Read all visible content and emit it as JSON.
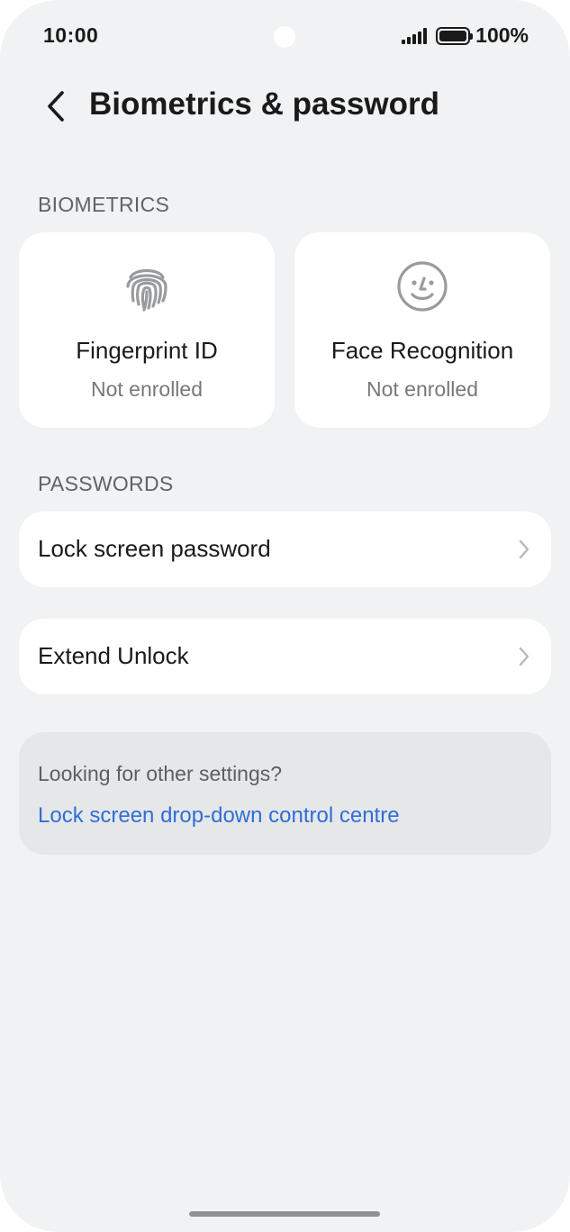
{
  "status_bar": {
    "time": "10:00",
    "battery_text": "100%"
  },
  "header": {
    "title": "Biometrics & password",
    "back_icon": "chevron-left-icon"
  },
  "biometrics": {
    "section_label": "BIOMETRICS",
    "cards": [
      {
        "title": "Fingerprint ID",
        "status": "Not enrolled",
        "icon": "fingerprint-icon"
      },
      {
        "title": "Face Recognition",
        "status": "Not enrolled",
        "icon": "face-icon"
      }
    ]
  },
  "passwords": {
    "section_label": "PASSWORDS",
    "items": [
      {
        "label": "Lock screen password"
      },
      {
        "label": "Extend Unlock"
      }
    ]
  },
  "hint": {
    "text": "Looking for other settings?",
    "link": "Lock screen drop-down control centre"
  },
  "colors": {
    "background": "#f1f2f4",
    "card": "#ffffff",
    "link": "#2f6ed6",
    "hint_card": "#e6e7e9"
  }
}
